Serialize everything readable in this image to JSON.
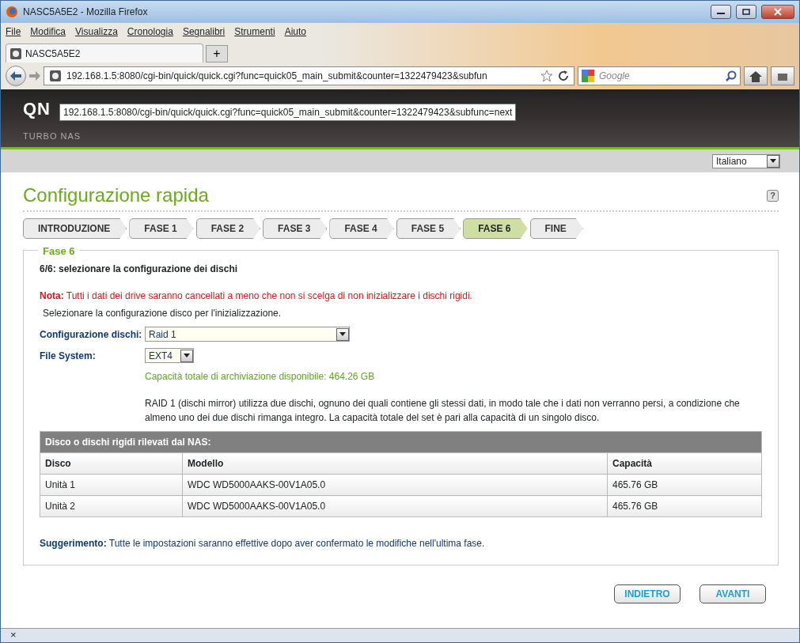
{
  "window": {
    "title": "NASC5A5E2 - Mozilla Firefox"
  },
  "menu": [
    "File",
    "Modifica",
    "Visualizza",
    "Cronologia",
    "Segnalibri",
    "Strumenti",
    "Aiuto"
  ],
  "tab": {
    "title": "NASC5A5E2",
    "new_tab": "+"
  },
  "address_bar": {
    "value": "192.168.1.5:8080/cgi-bin/quick/quick.cgi?func=quick05_main_submit&counter=1322479423&subfun"
  },
  "search": {
    "placeholder": "Google"
  },
  "header": {
    "logo": "QN",
    "subtitle": "TURBO NAS",
    "tooltip": "192.168.1.5:8080/cgi-bin/quick/quick.cgi?func=quick05_main_submit&counter=1322479423&subfunc=next"
  },
  "language": {
    "value": "Italiano"
  },
  "page_title": "Configurazione rapida",
  "help": "?",
  "steps": [
    {
      "label": "INTRODUZIONE",
      "selected": false
    },
    {
      "label": "FASE 1",
      "selected": false
    },
    {
      "label": "FASE 2",
      "selected": false
    },
    {
      "label": "FASE 3",
      "selected": false
    },
    {
      "label": "FASE 4",
      "selected": false
    },
    {
      "label": "FASE 5",
      "selected": false
    },
    {
      "label": "FASE 6",
      "selected": true
    },
    {
      "label": "FINE",
      "selected": false
    }
  ],
  "section": {
    "legend": "Fase 6",
    "heading": "6/6: selezionare la configurazione dei dischi",
    "note": "**Nota:** Tutti i dati dei drive saranno cancellati a meno che non si scelga di non inizializzare i dischi rigidi.",
    "instruction": "Selezionare la configurazione disco per l'inizializzazione.",
    "fields": [
      {
        "label": "Configurazione dischi:",
        "value": "Raid 1",
        "kind": "wide"
      },
      {
        "label": "File System:",
        "value": "EXT4",
        "kind": "narrow"
      }
    ],
    "capacity": "Capacità totale di archiviazione disponibile: 464.26 GB",
    "description": "RAID 1 (dischi mirror) utilizza due dischi, ognuno dei quali contiene gli stessi dati, in modo tale che i dati non verranno persi, a condizione che almeno uno dei due dischi rimanga integro. La capacità totale del set è pari alla capacità di un singolo disco.",
    "table": {
      "caption": "Disco o dischi rigidi rilevati dal NAS:",
      "columns": [
        "Disco",
        "Modello",
        "Capacità"
      ],
      "rows": [
        [
          "Unità 1",
          "WDC WD5000AAKS-00V1A05.0",
          "465.76 GB"
        ],
        [
          "Unità 2",
          "WDC WD5000AAKS-00V1A05.0",
          "465.76 GB"
        ]
      ]
    },
    "hint": "**Suggerimento:** Tutte le impostazioni saranno effettive dopo aver confermato le modifiche nell'ultima fase."
  },
  "buttons": [
    "INDIETRO",
    "AVANTI"
  ],
  "status_bar": {
    "close": "×"
  }
}
